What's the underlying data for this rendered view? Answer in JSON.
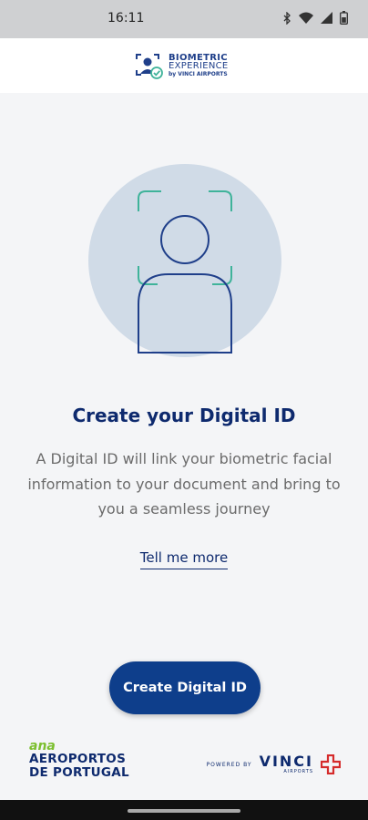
{
  "status_bar": {
    "time": "16:11",
    "icons": [
      "bluetooth-icon",
      "wifi-icon",
      "signal-icon",
      "battery-icon"
    ]
  },
  "header": {
    "brand_line1": "BIOMETRIC",
    "brand_line2": "EXPERIENCE",
    "brand_line3": "by VINCI AIRPORTS"
  },
  "main": {
    "title": "Create your Digital ID",
    "description": "A Digital ID will link your biometric facial information to your document and bring to you a seamless journey",
    "link_label": "Tell me more",
    "cta_label": "Create Digital ID"
  },
  "footer": {
    "ana_mark": "ana",
    "ana_line1": "AEROPORTOS",
    "ana_line2": "DE PORTUGAL",
    "powered_by": "POWERED BY",
    "vinci_name": "VINCI",
    "vinci_sub": "AIRPORTS"
  },
  "colors": {
    "primary": "#0e3e8b",
    "accent": "#3fb39a",
    "illustration_bg": "#d0dbe7",
    "background": "#f4f5f7"
  }
}
